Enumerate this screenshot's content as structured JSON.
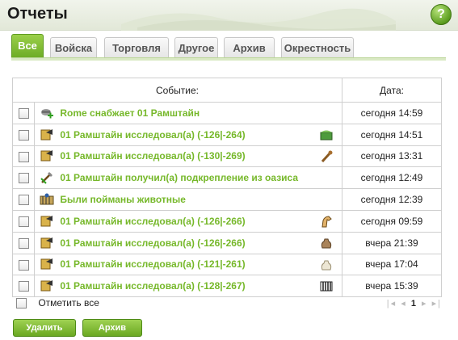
{
  "header": {
    "title": "Отчеты",
    "help_label": "?"
  },
  "tabs": [
    {
      "label": "Все",
      "active": true
    },
    {
      "label": "Войска"
    },
    {
      "label": "Торговля"
    },
    {
      "label": "Другое"
    },
    {
      "label": "Архив"
    },
    {
      "label": "Окрестность"
    }
  ],
  "table": {
    "col_event": "Событие:",
    "col_date": "Дата:",
    "rows": [
      {
        "icon": "trade-support-icon",
        "text": "Rome снабжает 01 Рамштайн",
        "resource_icon": "",
        "date": "сегодня 14:59"
      },
      {
        "icon": "scout-report-icon",
        "text": "01 Рамштайн исследовал(а) (-126|-264)",
        "resource_icon": "treasure-chest-icon",
        "date": "сегодня 14:51"
      },
      {
        "icon": "scout-report-icon",
        "text": "01 Рамштайн исследовал(а) (-130|-269)",
        "resource_icon": "wooden-club-icon",
        "date": "сегодня 13:31"
      },
      {
        "icon": "reinforcement-icon",
        "text": "01 Рамштайн получил(а) подкрепление из оазиса",
        "resource_icon": "",
        "date": "сегодня 12:49"
      },
      {
        "icon": "animals-icon",
        "text": "Были пойманы животные",
        "resource_icon": "",
        "date": "сегодня 12:39"
      },
      {
        "icon": "scout-report-icon",
        "text": "01 Рамштайн исследовал(а) (-126|-266)",
        "resource_icon": "horse-icon",
        "date": "сегодня 09:59"
      },
      {
        "icon": "scout-report-icon",
        "text": "01 Рамштайн исследовал(а) (-126|-266)",
        "resource_icon": "sack-icon",
        "date": "вчера 21:39"
      },
      {
        "icon": "scout-report-icon",
        "text": "01 Рамштайн исследовал(а) (-121|-261)",
        "resource_icon": "empty-sack-icon",
        "date": "вчера 17:04"
      },
      {
        "icon": "scout-report-icon",
        "text": "01 Рамштайн исследовал(а) (-128|-267)",
        "resource_icon": "cage-icon",
        "date": "вчера 15:39"
      }
    ]
  },
  "footer": {
    "select_all_label": "Отметить все",
    "pager": {
      "first": "|◂",
      "prev": "◂",
      "current": "1",
      "next": "▸",
      "last": "▸|"
    },
    "delete_label": "Удалить",
    "archive_label": "Архив"
  },
  "colors": {
    "accent": "#76b82a",
    "tab_active": "#7dbb2f",
    "border": "#cfcfcf"
  }
}
